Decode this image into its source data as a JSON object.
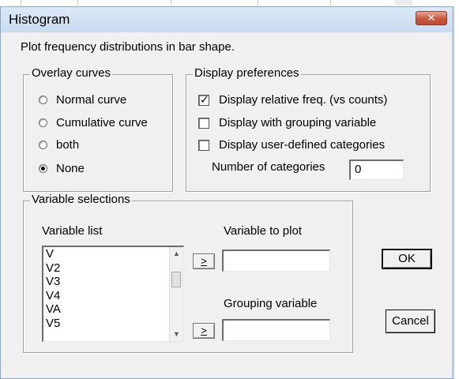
{
  "window": {
    "title": "Histogram",
    "close_label": "✕"
  },
  "description": "Plot frequency distributions in bar shape.",
  "overlay": {
    "legend": "Overlay curves",
    "options": [
      {
        "label": "Normal curve",
        "checked": false
      },
      {
        "label": "Cumulative curve",
        "checked": false
      },
      {
        "label": "both",
        "checked": false
      },
      {
        "label": "None",
        "checked": true
      }
    ]
  },
  "display": {
    "legend": "Display preferences",
    "checkboxes": [
      {
        "label": "Display relative freq. (vs counts)",
        "checked": true
      },
      {
        "label": "Display with grouping variable",
        "checked": false
      },
      {
        "label": "Display user-defined categories",
        "checked": false
      }
    ],
    "num_categories_label": "Number of categories",
    "num_categories_value": "0"
  },
  "variables": {
    "legend": "Variable selections",
    "list_label": "Variable list",
    "items": [
      "V",
      "V2",
      "V3",
      "V4",
      "VA",
      "V5"
    ],
    "plot_label": "Variable to plot",
    "plot_value": "",
    "grouping_label": "Grouping variable",
    "grouping_value": "",
    "arrow_label": ">"
  },
  "buttons": {
    "ok": "OK",
    "cancel": "Cancel"
  },
  "colors": {
    "title_bg": "#c8dbf0",
    "close_bg": "#c75a3f",
    "dialog_bg": "#f0f0f0"
  }
}
